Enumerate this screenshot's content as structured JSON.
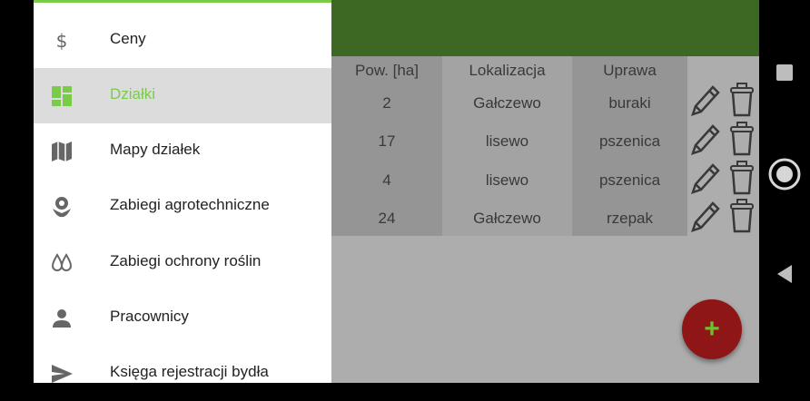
{
  "table": {
    "headers": {
      "pow": "Pow. [ha]",
      "lokalizacja": "Lokalizacja",
      "uprawa": "Uprawa"
    },
    "rows": [
      {
        "pow": "2",
        "lokalizacja": "Gałczewo",
        "uprawa": "buraki"
      },
      {
        "pow": "17",
        "lokalizacja": "lisewo",
        "uprawa": "pszenica"
      },
      {
        "pow": "4",
        "lokalizacja": "lisewo",
        "uprawa": "pszenica"
      },
      {
        "pow": "24",
        "lokalizacja": "Gałczewo",
        "uprawa": "rzepak"
      }
    ],
    "row_icons": [
      "pencil-icon",
      "trash-icon"
    ]
  },
  "fab": {
    "label": "+",
    "icon": "add-icon"
  },
  "drawer": {
    "items": [
      {
        "label": "Ceny",
        "icon": "dollar-icon"
      },
      {
        "label": "Działki",
        "icon": "dashboard-icon",
        "active": true
      },
      {
        "label": "Mapy działek",
        "icon": "map-icon"
      },
      {
        "label": "Zabiegi agrotechniczne",
        "icon": "flower-icon"
      },
      {
        "label": "Zabiegi ochrony roślin",
        "icon": "drops-icon"
      },
      {
        "label": "Pracownicy",
        "icon": "person-icon"
      },
      {
        "label": "Księga rejestracji bydła",
        "icon": "send-icon"
      }
    ]
  },
  "system_nav": [
    "recent-apps-icon",
    "home-icon",
    "back-icon"
  ],
  "colors": {
    "appbar": "#5a9a35",
    "accent": "#7acb4a",
    "fab": "#8e1616"
  }
}
